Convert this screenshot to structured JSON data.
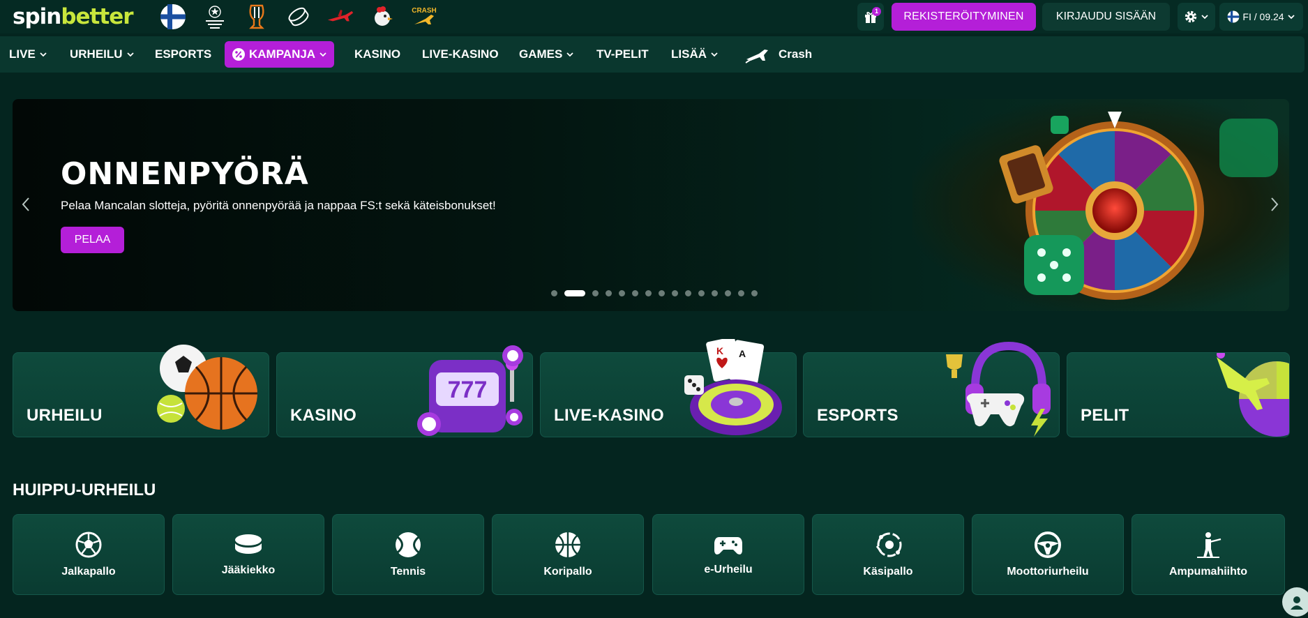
{
  "header": {
    "logo": {
      "part1": "spin",
      "part2": "better"
    },
    "quick_links": [
      "finland-flag",
      "champions-league",
      "europa-league",
      "ice-hockey-puck",
      "aviator-plane",
      "chicken-road",
      "crash"
    ],
    "gift_badge": "1",
    "register_label": "REKISTERÖITYMINEN",
    "login_label": "KIRJAUDU SISÄÄN",
    "lang_time": "FI / 09.24"
  },
  "nav": {
    "items": [
      {
        "label": "LIVE",
        "dropdown": true
      },
      {
        "label": "URHEILU",
        "dropdown": true
      },
      {
        "label": "ESPORTS",
        "dropdown": false
      },
      {
        "label": "KAMPANJA",
        "dropdown": true,
        "active": true
      },
      {
        "label": "KASINO",
        "dropdown": false
      },
      {
        "label": "LIVE-KASINO",
        "dropdown": false
      },
      {
        "label": "GAMES",
        "dropdown": true
      },
      {
        "label": "TV-PELIT",
        "dropdown": false
      },
      {
        "label": "LISÄÄ",
        "dropdown": true
      },
      {
        "label": "Crash",
        "dropdown": false
      }
    ]
  },
  "banner": {
    "title": "ONNENPYÖRÄ",
    "subtitle": "Pelaa Mancalan slotteja, pyöritä onnenpyörää ja nappaa FS:t sekä käteisbonukset!",
    "button_label": "PELAA",
    "dot_count": 15,
    "active_dot": 1
  },
  "categories": [
    {
      "label": "URHEILU",
      "art": "sports-balls"
    },
    {
      "label": "KASINO",
      "art": "slot-machine"
    },
    {
      "label": "LIVE-KASINO",
      "art": "roulette-cards"
    },
    {
      "label": "ESPORTS",
      "art": "headset-gamepad"
    },
    {
      "label": "PELIT",
      "art": "plane-wheel"
    }
  ],
  "top_sports": {
    "title": "HUIPPU-URHEILU",
    "items": [
      {
        "label": "Jalkapallo",
        "icon": "football-icon"
      },
      {
        "label": "Jääkiekko",
        "icon": "hockey-puck-icon"
      },
      {
        "label": "Tennis",
        "icon": "tennis-ball-icon"
      },
      {
        "label": "Koripallo",
        "icon": "basketball-icon"
      },
      {
        "label": "e-Urheilu",
        "icon": "gamepad-icon"
      },
      {
        "label": "Käsipallo",
        "icon": "handball-icon"
      },
      {
        "label": "Moottoriurheilu",
        "icon": "steering-wheel-icon"
      },
      {
        "label": "Ampumahiihto",
        "icon": "biathlon-icon"
      }
    ]
  },
  "colors": {
    "background": "#04251f",
    "accent": "#b41fd8",
    "logo_green": "#c8e63c",
    "card": "#0e4a3c"
  }
}
